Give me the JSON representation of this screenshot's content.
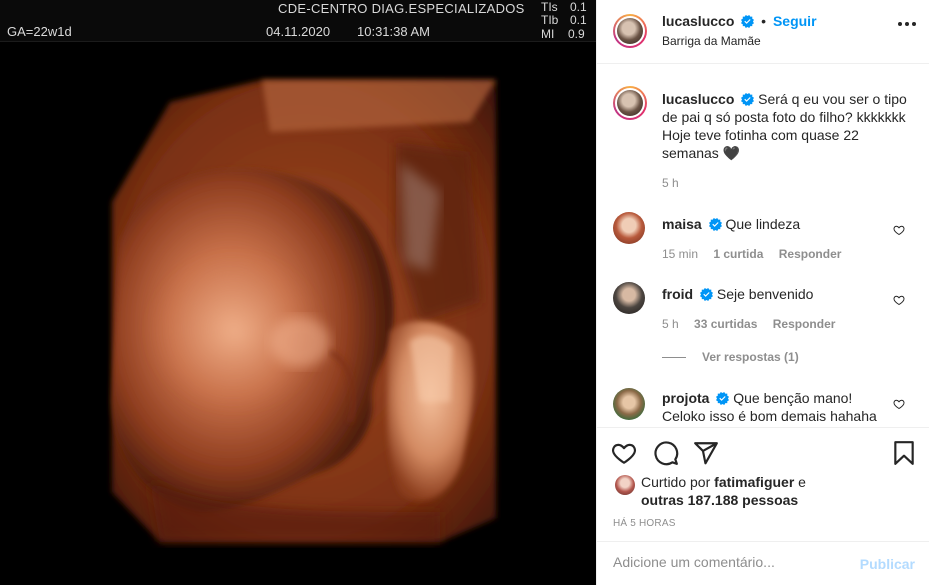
{
  "ultrasound": {
    "clinic": "CDE-CENTRO DIAG.ESPECIALIZADOS",
    "date": "04.11.2020",
    "time": "10:31:38 AM",
    "ga": "GA=22w1d",
    "tis_label": "TIs",
    "tis_value": "0.1",
    "tib_label": "TIb",
    "tib_value": "0.1",
    "mi_label": "MI",
    "mi_value": "0.9"
  },
  "header": {
    "username": "lucaslucco",
    "separator": "•",
    "follow_label": "Seguir",
    "location": "Barriga da Mamãe"
  },
  "caption": {
    "username": "lucaslucco",
    "text": "Será q eu vou ser o tipo de pai q só posta foto do filho? kkkkkkk Hoje teve fotinha com quase 22 semanas 🖤",
    "time": "5 h"
  },
  "comments": [
    {
      "username": "maisa",
      "text": "Que lindeza",
      "time": "15 min",
      "likes": "1 curtida",
      "reply_label": "Responder"
    },
    {
      "username": "froid",
      "text": "Seje benvenido",
      "time": "5 h",
      "likes": "33 curtidas",
      "reply_label": "Responder",
      "view_replies": "Ver respostas (1)"
    },
    {
      "username": "projota",
      "text": "Que benção mano! Celoko isso é bom demais hahaha"
    }
  ],
  "likes": {
    "prefix": "Curtido por",
    "user": "fatimafiguer",
    "connector": "e",
    "others": "outras 187.188 pessoas"
  },
  "posted_ago": "HÁ 5 HORAS",
  "add_comment": {
    "placeholder": "Adicione um comentário...",
    "publish_label": "Publicar"
  },
  "colors": {
    "accent": "#0095f6",
    "publish_disabled": "#b3dbff",
    "muted": "#8e8e8e"
  },
  "icons": [
    "heart-icon",
    "comment-icon",
    "share-icon",
    "bookmark-icon",
    "more-icon",
    "verified-icon"
  ]
}
